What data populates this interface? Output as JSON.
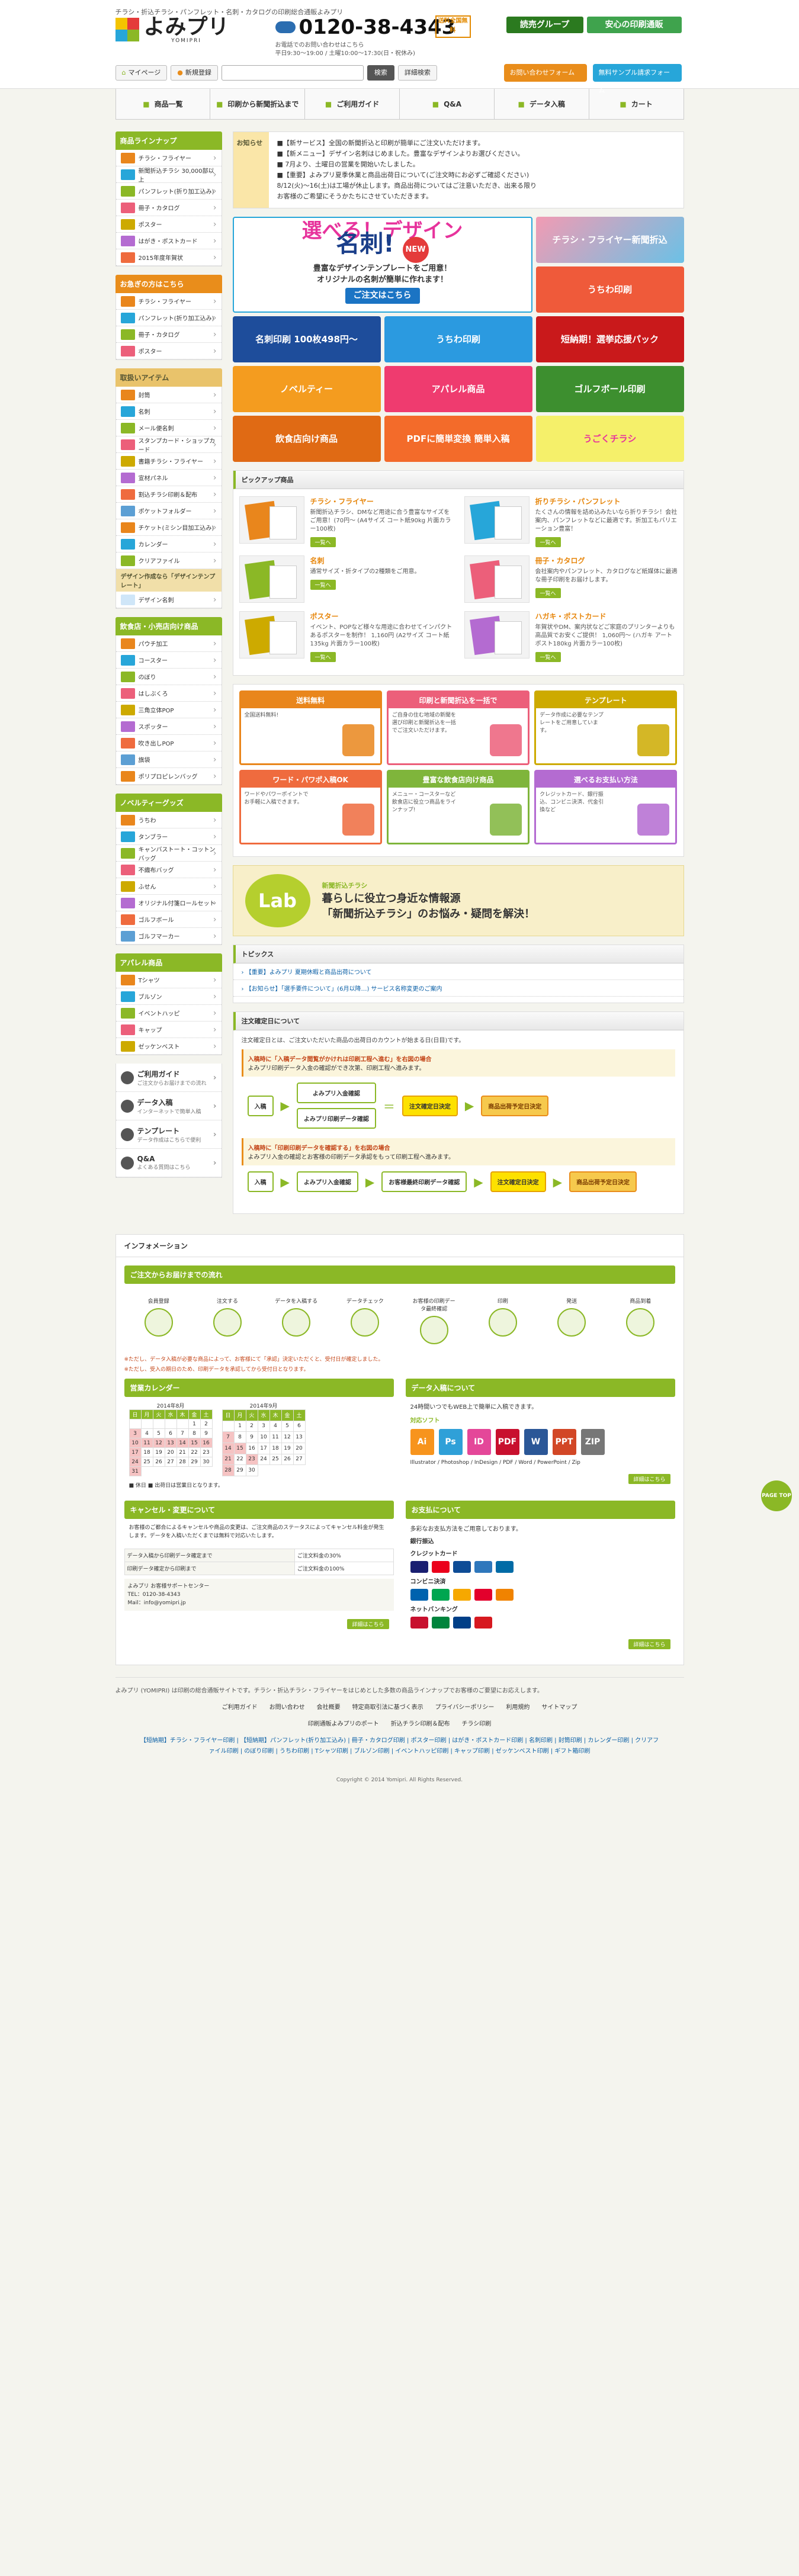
{
  "header": {
    "tagline": "チラシ・折込チラシ・パンフレット・名刺・カタログの印刷総合通販よみプリ",
    "logo_text": "よみプリ",
    "logo_sub": "YOMIPRI",
    "phone": "0120-38-4343",
    "hours": "お電話でのお問い合わせはこちら",
    "hours2": "平日9:30〜19:00 / 土曜10:00〜17:30(日・祝休み)",
    "yen_badge": "送料全国無料",
    "group1": "読売グループ",
    "group2": "安心の印刷通販",
    "mypage": "マイページ",
    "register": "新規登録",
    "search_placeholder": "",
    "search_btn": "検索",
    "detail_btn": "詳細検索",
    "help1": "お問い合わせフォーム",
    "help2": "無料サンプル請求フォーム",
    "colors": {
      "brand": "#8bb826",
      "accent": "#e98d1b",
      "blue": "#27a6d9"
    }
  },
  "gnav": [
    {
      "label": "商品一覧",
      "icon": "book-icon"
    },
    {
      "label": "印刷から新聞折込まで",
      "icon": "print-icon"
    },
    {
      "label": "ご利用ガイド",
      "icon": "info-icon"
    },
    {
      "label": "Q&A",
      "icon": "question-icon"
    },
    {
      "label": "データ入稿",
      "icon": "upload-icon"
    },
    {
      "label": "カート",
      "icon": "cart-icon"
    }
  ],
  "sidebar": {
    "lineup_title": "商品ラインナップ",
    "lineup": [
      "チラシ・フライヤー",
      "新聞折込チラシ 30,000部以上",
      "パンフレット(折り加工込み)",
      "冊子・カタログ",
      "ポスター",
      "はがき・ポストカード",
      "2015年度年賀状"
    ],
    "osusume_title": "お急ぎの方はこちら",
    "osusume": [
      "チラシ・フライヤー",
      "パンフレット(折り加工込み)",
      "冊子・カタログ",
      "ポスター"
    ],
    "items_title": "取扱いアイテム",
    "items": [
      "封筒",
      "名刺",
      "メール便名刺",
      "スタンプカード・ショップカード",
      "書籍チラシ・フライヤー",
      "宣材パネル",
      "割込チラシ印刷＆配布",
      "ポケットフォルダー",
      "チケット(ミシン目加工込み)",
      "カレンダー",
      "クリアファイル"
    ],
    "design_label": "デザイン作成なら「デザインテンプレート」",
    "design_item": "デザイン名刺",
    "food_title": "飲食店・小売店向け商品",
    "food": [
      "パウチ加工",
      "コースター",
      "のぼり",
      "はしぶくろ",
      "三角立体POP",
      "スポッター",
      "吹き出しPOP",
      "旗袋",
      "ポリプロピレンバッグ"
    ],
    "novelty_title": "ノベルティーグッズ",
    "novelty": [
      "うちわ",
      "タンブラー",
      "キャンバストート・コットンバッグ",
      "不織布バッグ",
      "ふせん",
      "オリジナル付箋ロールセット",
      "ゴルフボール",
      "ゴルフマーカー"
    ],
    "apparel_title": "アパレル商品",
    "apparel": [
      "Tシャツ",
      "ブルゾン",
      "イベントハッピ",
      "キャップ",
      "ゼッケンベスト"
    ],
    "guides": [
      {
        "label": "ご利用ガイド",
        "sub": "ご注文からお届けまでの流れ",
        "icon": "guide-icon"
      },
      {
        "label": "データ入稿",
        "sub": "インターネットで簡単入稿",
        "icon": "upload-icon"
      },
      {
        "label": "テンプレート",
        "sub": "データ作成はこちらで便利",
        "icon": "template-icon"
      },
      {
        "label": "Q&A",
        "sub": "よくある質問はこちら",
        "icon": "question-icon"
      }
    ]
  },
  "notice": {
    "tag": "お知らせ",
    "lines": [
      "■【新サービス】全国の新聞折込と印刷が簡単にご注文いただけます。",
      "■【新メニュー】デザイン名刺はじめました。豊富なデザインよりお選びください。",
      "■ 7月より、土曜日の営業を開始いたしました。",
      "■【重要】よみプリ夏季休業と商品出荷日について(ご注文時にお必ずご確認ください)",
      "8/12(火)〜16(土)は工場が休止します。商品出荷についてはご注意いただき、出来る限り",
      "お客様のご希望にそうかたちにさせていただきます。"
    ]
  },
  "banners": {
    "big_line1": "選べる！デザイン",
    "big_line2": "名刺!",
    "big_new": "NEW",
    "big_sub": "豊富なデザインテンプレートをご用意！",
    "big_sub2": "オリジナルの名刺が簡単に作れます！",
    "big_cta": "ご注文はこちら",
    "side1": "チラシ・フライヤー新聞折込",
    "side2": "うちわ印刷",
    "b3": "名刺印刷 100枚498円〜",
    "b4": "うちわ印刷",
    "b5": "短納期！選挙応援パック",
    "b6": "ノベルティー",
    "b7": "アパレル商品",
    "b8": "ゴルフボール印刷",
    "b9": "飲食店向け商品",
    "b10": "PDFに簡単変換 簡単入稿",
    "b11": "うごくチラシ"
  },
  "pickup": {
    "title": "ピックアップ商品",
    "items": [
      {
        "title": "チラシ・フライヤー",
        "desc": "新聞折込チラシ、DMなど用途に合う豊富なサイズをご用意！(70円〜 (A4サイズ コート紙90kg 片面カラー100枚)",
        "more": "一覧へ"
      },
      {
        "title": "折りチラシ・パンフレット",
        "desc": "たくさんの情報を詰め込みたいなら折りチラシ！会社案内、パンフレットなどに最適です。折加工もバリエーション豊富！",
        "more": "一覧へ"
      },
      {
        "title": "名刺",
        "desc": "通常サイズ・折タイプの2種類をご用意。",
        "more": "一覧へ"
      },
      {
        "title": "冊子・カタログ",
        "desc": "会社案内やパンフレット、カタログなど紙媒体に最適な冊子印刷をお届けします。",
        "more": "一覧へ"
      },
      {
        "title": "ポスター",
        "desc": "イベント、POPなど様々な用途に合わせてインパクトあるポスターを制作！ 1,160円 (A2サイズ コート紙 135kg 片面カラー100枚)",
        "more": "一覧へ"
      },
      {
        "title": "ハガキ・ポストカード",
        "desc": "年賀状やDM、案内状などご家庭のプリンターよりも高品質でお安くご提供！ 1,060円〜 (ハガキ アートポスト180kg 片面カラー100枚)",
        "more": "一覧へ"
      }
    ]
  },
  "features": [
    {
      "title": "送料無料",
      "body": "全国送料無料!",
      "color": "#e9861c"
    },
    {
      "title": "印刷と新聞折込を一括で",
      "body": "ご自身の住む地域の新聞を選び印刷と新聞折込を一括でご注文いただけます。",
      "color": "#ec5f7a"
    },
    {
      "title": "テンプレート",
      "body": "データ作成に必要なテンプレートをご用意しています。",
      "color": "#cdaa00"
    },
    {
      "title": "ワード・パワポ入稿OK",
      "body": "ワードやパワーポイントでお手軽に入稿できます。",
      "color": "#ef6b3e"
    },
    {
      "title": "豊富な飲食店向け商品",
      "body": "メニュー・コースターなど飲食店に役立つ商品をラインナップ!",
      "color": "#7fb53b"
    },
    {
      "title": "選べるお支払い方法",
      "body": "クレジットカード、銀行振込、コンビニ決済、代金引換など",
      "color": "#b46bd1"
    }
  ],
  "lab": {
    "logo": "Lab",
    "line1": "暮らしに役立つ身近な情報源",
    "line2": "「新聞折込チラシ」のお悩み・疑問を解決！",
    "caption": "新聞折込チラシ"
  },
  "topics": {
    "title": "トピックス",
    "items": [
      "【重要】よみプリ 夏期休暇と商品出荷について",
      "【お知らせ】「選手要件について」(6月以降…) サービス名称変更のご案内"
    ]
  },
  "flow": {
    "title": "注文確定日について",
    "intro": "注文確定日とは、ご注文いただいた商品の出荷日のカウントが始まる日(日目)です。",
    "case1": "入稿時に「入稿データ閲覧がかけれは印刷工程へ進む」を右図の場合",
    "case1b": "よみプリ印刷データ入金の確認ができ次第、印刷工程へ進みます。",
    "case2": "入稿時に「印刷印刷データを確認する」を右図の場合",
    "case2b": "よみプリ入金の確認とお客様の印刷データ承認をもって印刷工程へ進みます。",
    "start": "入稿",
    "box1": "よみプリ入金確認",
    "box2": "よみプリ印刷データ確認",
    "box3": "お客様最終印刷データ確認",
    "confirm": "注文確定日決定",
    "ship": "商品出荷予定日決定"
  },
  "info": {
    "title": "インフォメーション",
    "flow_title": "ご注文からお届けまでの流れ",
    "steps": [
      "会員登録",
      "注文する",
      "データを入稿する",
      "データチェック",
      "お客様の印刷データ最終確認",
      "印刷",
      "発送",
      "商品到着"
    ],
    "caution1": "※ただし、データ入稿が必要な商品によって、お客様にて「承認」決定いただくと、受付日が確定しました。",
    "caution2": "※ただし、受入の期日のため、印刷データを承認してから受付日となります。",
    "cal_title": "営業カレンダー",
    "cal_month1": "2014年8月",
    "cal_month2": "2014年9月",
    "cal_note": "■ 休日 ■ 出荷日は営業日となります。",
    "data_title": "データ入稿について",
    "data_body": "24時間いつでもWEB上で簡単に入稿できます。",
    "software": "対応ソフト",
    "software_list": "Illustrator / Photoshop / InDesign / PDF / Word / PowerPoint / Zip",
    "filetypes": [
      {
        "label": "Ai",
        "color": "#f7941d"
      },
      {
        "label": "Ps",
        "color": "#2fa0d8"
      },
      {
        "label": "ID",
        "color": "#e44799"
      },
      {
        "label": "PDF",
        "color": "#c8102e"
      },
      {
        "label": "W",
        "color": "#2b5797"
      },
      {
        "label": "PPT",
        "color": "#d24726"
      },
      {
        "label": "ZIP",
        "color": "#777"
      }
    ],
    "more": "詳細はこちら",
    "cancel_title": "キャンセル・変更について",
    "cancel_body": "お客様のご都合によるキャンセルや商品の変更は、ご注文商品のステータスによってキャンセル料金が発生します。データを入稿いただくまでは無料で対応いたします。",
    "cancel_rows": [
      "データ入稿から印刷データ確定まで",
      "印刷データ確定から印刷まで"
    ],
    "cancel_fee": [
      "ご注文料金の30%",
      "ご注文料金の100%"
    ],
    "support": "よみプリ お客様サポートセンター",
    "support_tel": "TEL：0120-38-4343",
    "support_mail": "Mail：info@yomipri.jp",
    "pay_title": "お支払について",
    "pay_body": "多彩なお支払方法をご用意しております。",
    "pay_labels": [
      "銀行振込",
      "クレジットカード",
      "コンビニ決済",
      "ネットバンキング"
    ]
  },
  "footer": {
    "about": "よみプリ (YOMIPRI) は印刷の総合通販サイトです。チラシ・折込チラシ・フライヤーをはじめとした多数の商品ラインナップでお客様のご要望にお応えします。",
    "links": [
      "ご利用ガイド",
      "お問い合わせ",
      "会社概要",
      "特定商取引法に基づく表示",
      "プライバシーポリシー",
      "利用規約",
      "サイトマップ"
    ],
    "links2": [
      "印刷通販よみプリのポート",
      "折込チラシ印刷＆配布",
      "チラシ印刷"
    ],
    "tags": "【短納期】チラシ・フライヤー印刷 | 【短納期】パンフレット(折り加工込み) | 冊子・カタログ印刷 | ポスター印刷 | はがき・ポストカード印刷 | 名刺印刷 | 封筒印刷 | カレンダー印刷 | クリアファイル印刷 | のぼり印刷 | うちわ印刷 | Tシャツ印刷 | ブルゾン印刷 | イベントハッピ印刷 | キャップ印刷 | ゼッケンベスト印刷 | ギフト箱印刷",
    "copyright": "Copyright © 2014 Yomipri. All Rights Reserved.",
    "pagetop": "PAGE TOP"
  }
}
